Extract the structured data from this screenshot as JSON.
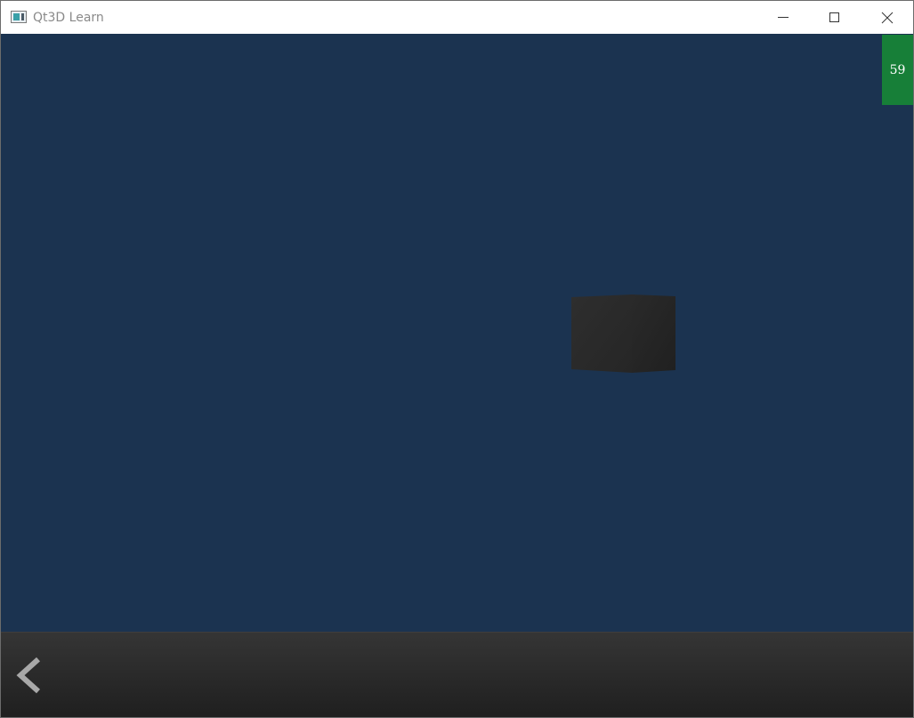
{
  "window": {
    "title": "Qt3D Learn",
    "controls": {
      "minimize_icon": "minimize-icon",
      "maximize_icon": "maximize-icon",
      "close_icon": "close-icon"
    }
  },
  "viewport": {
    "background_color": "#1b3350",
    "fps": "59",
    "fps_badge_color": "#177f38",
    "object": "cube"
  },
  "bottom_bar": {
    "back_icon": "chevron-left-icon"
  }
}
